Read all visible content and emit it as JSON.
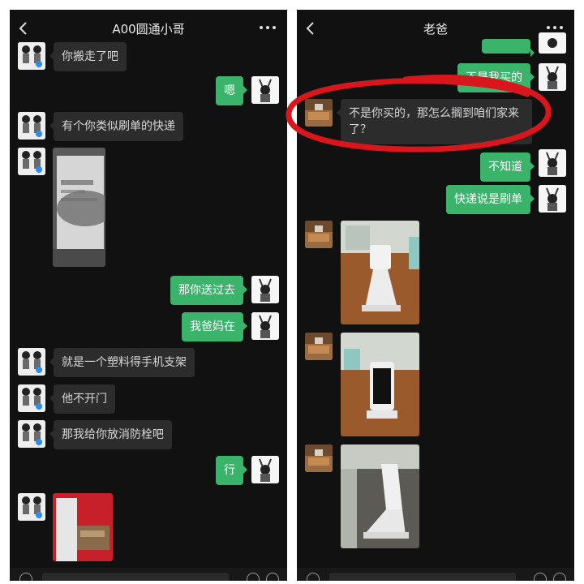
{
  "left_chat": {
    "title": "A00圆通小哥",
    "messages": [
      {
        "from": "them",
        "text": "你搬走了吧"
      },
      {
        "from": "me",
        "text": "嗯"
      },
      {
        "from": "them",
        "text": "有个你类似刷单的快递"
      },
      {
        "from": "them",
        "type": "image",
        "icon": "package-photo"
      },
      {
        "from": "me",
        "text": "那你送过去"
      },
      {
        "from": "me",
        "text": "我爸妈在"
      },
      {
        "from": "them",
        "text": "就是一个塑料得手机支架"
      },
      {
        "from": "them",
        "text": "他不开门"
      },
      {
        "from": "them",
        "text": "那我给你放消防栓吧"
      },
      {
        "from": "me",
        "text": "行"
      },
      {
        "from": "them",
        "type": "image",
        "icon": "fire-box-photo"
      }
    ]
  },
  "right_chat": {
    "title": "老爸",
    "messages": [
      {
        "from": "me",
        "text": "不是我买的"
      },
      {
        "from": "them",
        "text": "不是你买的，那怎么搁到咱们家来了？"
      },
      {
        "from": "me",
        "text": "不知道"
      },
      {
        "from": "me",
        "text": "快递说是刷单"
      },
      {
        "from": "them",
        "type": "image",
        "icon": "phone-stand-photo"
      },
      {
        "from": "them",
        "type": "image",
        "icon": "phone-on-stand-photo"
      },
      {
        "from": "them",
        "type": "image",
        "icon": "stand-side-photo"
      }
    ]
  },
  "annotation": {
    "color": "#d9161c",
    "icon": "red-hand-drawn-circle"
  },
  "colors": {
    "background": "#111111",
    "incoming_bubble": "#2c2c2c",
    "outgoing_bubble": "#3ab46a"
  }
}
